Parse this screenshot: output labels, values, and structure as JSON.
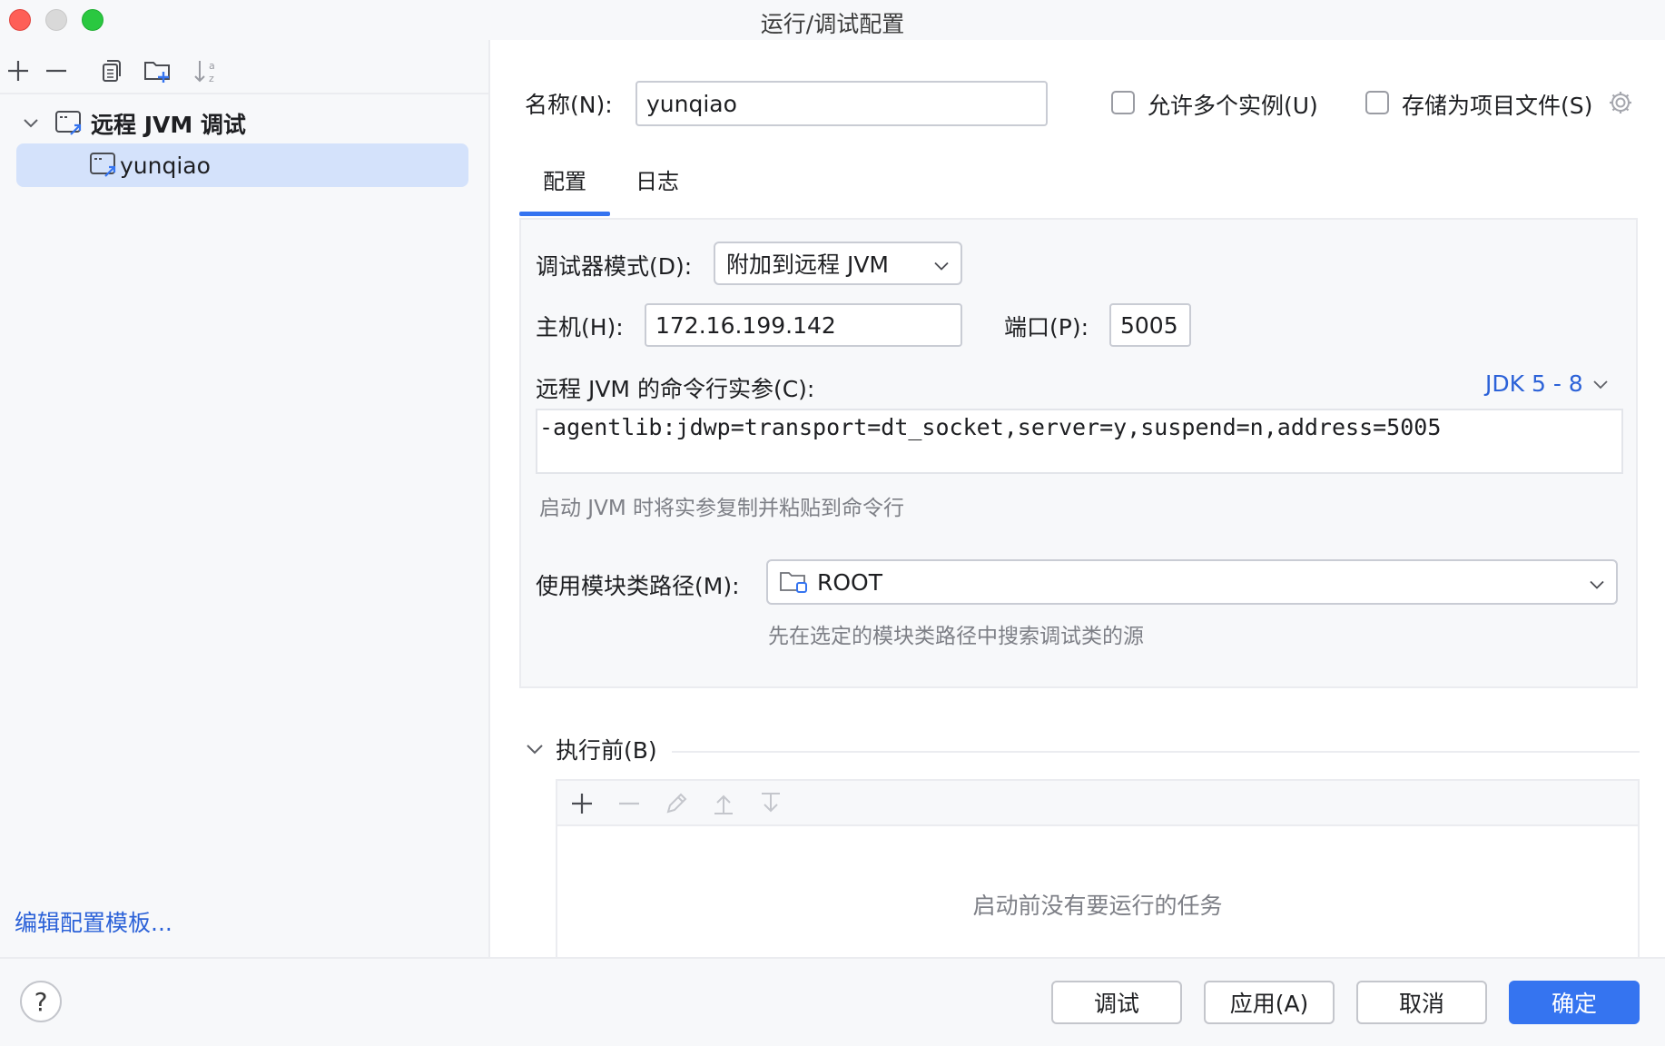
{
  "window": {
    "title": "运行/调试配置"
  },
  "sidebar": {
    "group_label": "远程 JVM 调试",
    "item_label": "yunqiao",
    "edit_templates_link": "编辑配置模板..."
  },
  "form": {
    "name_label": "名称(N):",
    "name_value": "yunqiao",
    "allow_parallel_label": "允许多个实例(U)",
    "allow_parallel_checked": false,
    "store_as_file_label": "存储为项目文件(S)",
    "store_as_file_checked": false
  },
  "tabs": [
    {
      "label": "配置",
      "active": true
    },
    {
      "label": "日志",
      "active": false
    }
  ],
  "config": {
    "debugger_mode_label": "调试器模式(D):",
    "debugger_mode_value": "附加到远程 JVM",
    "host_label": "主机(H):",
    "host_value": "172.16.199.142",
    "port_label": "端口(P):",
    "port_value": "5005",
    "cmd_args_label": "远程 JVM 的命令行实参(C):",
    "jdk_selector": "JDK 5 - 8",
    "cmd_args_value": "-agentlib:jdwp=transport=dt_socket,server=y,suspend=n,address=5005",
    "cmd_hint": "启动 JVM 时将实参复制并粘贴到命令行",
    "module_label": "使用模块类路径(M):",
    "module_value": "ROOT",
    "module_hint": "先在选定的模块类路径中搜索调试类的源"
  },
  "before_launch": {
    "title": "执行前(B)",
    "empty_text": "启动前没有要运行的任务"
  },
  "footer": {
    "help": "?",
    "debug_button": "调试",
    "apply_button": "应用(A)",
    "cancel_button": "取消",
    "ok_button": "确定"
  },
  "colors": {
    "accent": "#3574f0",
    "link": "#2c62d8",
    "selection": "#d4e2fb"
  }
}
